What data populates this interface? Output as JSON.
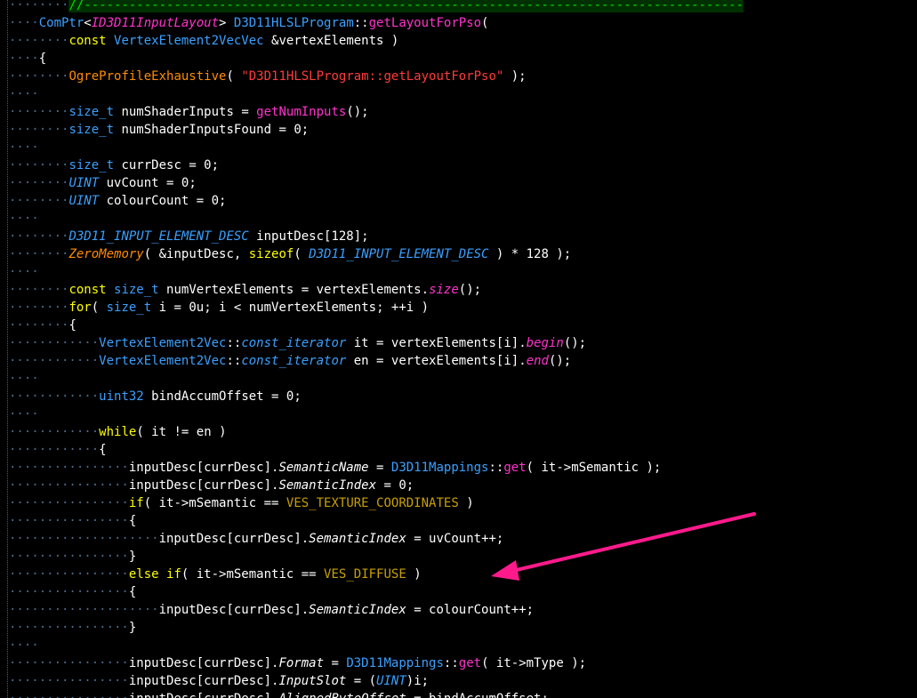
{
  "editor": {
    "language": "C++",
    "colors": {
      "background": "#000000",
      "keyword": "#ffff00",
      "type": "#3aa0ff",
      "function": "#ff33cc",
      "macro": "#ff8c00",
      "string": "#ff3b3b",
      "enum": "#c8a000",
      "comment": "#00e000",
      "annotation_arrow": "#ff1a8c"
    },
    "lines": [
      {
        "indent": 1,
        "tokens": [
          [
            "com",
            "//----------------------------------------------------------------------------------------"
          ]
        ]
      },
      {
        "indent": 0,
        "tokens": [
          [
            "type",
            "ComPtr"
          ],
          [
            "op",
            "<"
          ],
          [
            "tmpl",
            "ID3D11InputLayout"
          ],
          [
            "op",
            "> "
          ],
          [
            "type",
            "D3D11HLSLProgram"
          ],
          [
            "op",
            "::"
          ],
          [
            "fn",
            "getLayoutForPso"
          ],
          [
            "op",
            "("
          ]
        ]
      },
      {
        "indent": 1,
        "tokens": [
          [
            "kw",
            "const "
          ],
          [
            "type",
            "VertexElement2VecVec "
          ],
          [
            "op",
            "&"
          ],
          [
            "def",
            "vertexElements "
          ],
          [
            "op",
            ")"
          ]
        ]
      },
      {
        "indent": 0,
        "tokens": [
          [
            "op",
            "{"
          ]
        ]
      },
      {
        "indent": 1,
        "tokens": [
          [
            "macro",
            "OgreProfileExhaustive"
          ],
          [
            "op",
            "( "
          ],
          [
            "str",
            "\"D3D11HLSLProgram::getLayoutForPso\""
          ],
          [
            "op",
            " );"
          ]
        ]
      },
      {
        "indent": 0,
        "tokens": []
      },
      {
        "indent": 1,
        "tokens": [
          [
            "type",
            "size_t "
          ],
          [
            "def",
            "numShaderInputs "
          ],
          [
            "op",
            "= "
          ],
          [
            "fn",
            "getNumInputs"
          ],
          [
            "op",
            "();"
          ]
        ]
      },
      {
        "indent": 1,
        "tokens": [
          [
            "type",
            "size_t "
          ],
          [
            "def",
            "numShaderInputsFound "
          ],
          [
            "op",
            "= "
          ],
          [
            "num",
            "0"
          ],
          [
            "op",
            ";"
          ]
        ]
      },
      {
        "indent": 0,
        "tokens": []
      },
      {
        "indent": 1,
        "tokens": [
          [
            "type",
            "size_t "
          ],
          [
            "def",
            "currDesc "
          ],
          [
            "op",
            "= "
          ],
          [
            "num",
            "0"
          ],
          [
            "op",
            ";"
          ]
        ]
      },
      {
        "indent": 1,
        "tokens": [
          [
            "typi",
            "UINT "
          ],
          [
            "def",
            "uvCount "
          ],
          [
            "op",
            "= "
          ],
          [
            "num",
            "0"
          ],
          [
            "op",
            ";"
          ]
        ]
      },
      {
        "indent": 1,
        "tokens": [
          [
            "typi",
            "UINT "
          ],
          [
            "def",
            "colourCount "
          ],
          [
            "op",
            "= "
          ],
          [
            "num",
            "0"
          ],
          [
            "op",
            ";"
          ]
        ]
      },
      {
        "indent": 0,
        "tokens": []
      },
      {
        "indent": 1,
        "tokens": [
          [
            "typi",
            "D3D11_INPUT_ELEMENT_DESC "
          ],
          [
            "def",
            "inputDesc"
          ],
          [
            "op",
            "["
          ],
          [
            "num",
            "128"
          ],
          [
            "op",
            "];"
          ]
        ]
      },
      {
        "indent": 1,
        "tokens": [
          [
            "maci",
            "ZeroMemory"
          ],
          [
            "op",
            "( &"
          ],
          [
            "def",
            "inputDesc"
          ],
          [
            "op",
            ", "
          ],
          [
            "kw",
            "sizeof"
          ],
          [
            "op",
            "( "
          ],
          [
            "typi",
            "D3D11_INPUT_ELEMENT_DESC "
          ],
          [
            "op",
            ") * "
          ],
          [
            "num",
            "128 "
          ],
          [
            "op",
            ");"
          ]
        ]
      },
      {
        "indent": 0,
        "tokens": []
      },
      {
        "indent": 1,
        "tokens": [
          [
            "kw",
            "const "
          ],
          [
            "type",
            "size_t "
          ],
          [
            "def",
            "numVertexElements "
          ],
          [
            "op",
            "= "
          ],
          [
            "def",
            "vertexElements"
          ],
          [
            "op",
            "."
          ],
          [
            "fni",
            "size"
          ],
          [
            "op",
            "();"
          ]
        ]
      },
      {
        "indent": 1,
        "tokens": [
          [
            "kw",
            "for"
          ],
          [
            "op",
            "( "
          ],
          [
            "type",
            "size_t "
          ],
          [
            "def",
            "i "
          ],
          [
            "op",
            "= "
          ],
          [
            "num",
            "0u"
          ],
          [
            "op",
            "; "
          ],
          [
            "def",
            "i "
          ],
          [
            "op",
            "< "
          ],
          [
            "def",
            "numVertexElements"
          ],
          [
            "op",
            "; ++"
          ],
          [
            "def",
            "i "
          ],
          [
            "op",
            ")"
          ]
        ]
      },
      {
        "indent": 1,
        "tokens": [
          [
            "op",
            "{"
          ]
        ]
      },
      {
        "indent": 2,
        "tokens": [
          [
            "type",
            "VertexElement2Vec"
          ],
          [
            "op",
            "::"
          ],
          [
            "typi",
            "const_iterator "
          ],
          [
            "def",
            "it "
          ],
          [
            "op",
            "= "
          ],
          [
            "def",
            "vertexElements"
          ],
          [
            "op",
            "["
          ],
          [
            "def",
            "i"
          ],
          [
            "op",
            "]."
          ],
          [
            "fni",
            "begin"
          ],
          [
            "op",
            "();"
          ]
        ]
      },
      {
        "indent": 2,
        "tokens": [
          [
            "type",
            "VertexElement2Vec"
          ],
          [
            "op",
            "::"
          ],
          [
            "typi",
            "const_iterator "
          ],
          [
            "def",
            "en "
          ],
          [
            "op",
            "= "
          ],
          [
            "def",
            "vertexElements"
          ],
          [
            "op",
            "["
          ],
          [
            "def",
            "i"
          ],
          [
            "op",
            "]."
          ],
          [
            "fni",
            "end"
          ],
          [
            "op",
            "();"
          ]
        ]
      },
      {
        "indent": 0,
        "tokens": []
      },
      {
        "indent": 2,
        "tokens": [
          [
            "type",
            "uint32 "
          ],
          [
            "def",
            "bindAccumOffset "
          ],
          [
            "op",
            "= "
          ],
          [
            "num",
            "0"
          ],
          [
            "op",
            ";"
          ]
        ]
      },
      {
        "indent": 0,
        "tokens": []
      },
      {
        "indent": 2,
        "tokens": [
          [
            "kw",
            "while"
          ],
          [
            "op",
            "( "
          ],
          [
            "def",
            "it "
          ],
          [
            "op",
            "!= "
          ],
          [
            "def",
            "en "
          ],
          [
            "op",
            ")"
          ]
        ]
      },
      {
        "indent": 2,
        "tokens": [
          [
            "op",
            "{"
          ]
        ]
      },
      {
        "indent": 3,
        "tokens": [
          [
            "def",
            "inputDesc"
          ],
          [
            "op",
            "["
          ],
          [
            "def",
            "currDesc"
          ],
          [
            "op",
            "]."
          ],
          [
            "mem",
            "SemanticName "
          ],
          [
            "op",
            "= "
          ],
          [
            "type",
            "D3D11Mappings"
          ],
          [
            "op",
            "::"
          ],
          [
            "fn",
            "get"
          ],
          [
            "op",
            "( "
          ],
          [
            "def",
            "it"
          ],
          [
            "op",
            "->"
          ],
          [
            "def",
            "mSemantic "
          ],
          [
            "op",
            ");"
          ]
        ]
      },
      {
        "indent": 3,
        "tokens": [
          [
            "def",
            "inputDesc"
          ],
          [
            "op",
            "["
          ],
          [
            "def",
            "currDesc"
          ],
          [
            "op",
            "]."
          ],
          [
            "mem",
            "SemanticIndex "
          ],
          [
            "op",
            "= "
          ],
          [
            "num",
            "0"
          ],
          [
            "op",
            ";"
          ]
        ]
      },
      {
        "indent": 3,
        "tokens": [
          [
            "kw",
            "if"
          ],
          [
            "op",
            "( "
          ],
          [
            "def",
            "it"
          ],
          [
            "op",
            "->"
          ],
          [
            "def",
            "mSemantic "
          ],
          [
            "op",
            "== "
          ],
          [
            "enum",
            "VES_TEXTURE_COORDINATES "
          ],
          [
            "op",
            ")"
          ]
        ]
      },
      {
        "indent": 3,
        "tokens": [
          [
            "op",
            "{"
          ]
        ]
      },
      {
        "indent": 4,
        "tokens": [
          [
            "def",
            "inputDesc"
          ],
          [
            "op",
            "["
          ],
          [
            "def",
            "currDesc"
          ],
          [
            "op",
            "]."
          ],
          [
            "mem",
            "SemanticIndex "
          ],
          [
            "op",
            "= "
          ],
          [
            "def",
            "uvCount"
          ],
          [
            "op",
            "++;"
          ]
        ]
      },
      {
        "indent": 3,
        "tokens": [
          [
            "op",
            "}"
          ]
        ]
      },
      {
        "indent": 3,
        "tokens": [
          [
            "kw",
            "else "
          ],
          [
            "kw",
            "if"
          ],
          [
            "op",
            "( "
          ],
          [
            "def",
            "it"
          ],
          [
            "op",
            "->"
          ],
          [
            "def",
            "mSemantic "
          ],
          [
            "op",
            "== "
          ],
          [
            "enum",
            "VES_DIFFUSE "
          ],
          [
            "op",
            ")"
          ]
        ]
      },
      {
        "indent": 3,
        "tokens": [
          [
            "op",
            "{"
          ]
        ]
      },
      {
        "indent": 4,
        "tokens": [
          [
            "def",
            "inputDesc"
          ],
          [
            "op",
            "["
          ],
          [
            "def",
            "currDesc"
          ],
          [
            "op",
            "]."
          ],
          [
            "mem",
            "SemanticIndex "
          ],
          [
            "op",
            "= "
          ],
          [
            "def",
            "colourCount"
          ],
          [
            "op",
            "++;"
          ]
        ]
      },
      {
        "indent": 3,
        "tokens": [
          [
            "op",
            "}"
          ]
        ]
      },
      {
        "indent": 0,
        "tokens": []
      },
      {
        "indent": 3,
        "tokens": [
          [
            "def",
            "inputDesc"
          ],
          [
            "op",
            "["
          ],
          [
            "def",
            "currDesc"
          ],
          [
            "op",
            "]."
          ],
          [
            "mem",
            "Format "
          ],
          [
            "op",
            "= "
          ],
          [
            "type",
            "D3D11Mappings"
          ],
          [
            "op",
            "::"
          ],
          [
            "fn",
            "get"
          ],
          [
            "op",
            "( "
          ],
          [
            "def",
            "it"
          ],
          [
            "op",
            "->"
          ],
          [
            "def",
            "mType "
          ],
          [
            "op",
            ");"
          ]
        ]
      },
      {
        "indent": 3,
        "tokens": [
          [
            "def",
            "inputDesc"
          ],
          [
            "op",
            "["
          ],
          [
            "def",
            "currDesc"
          ],
          [
            "op",
            "]."
          ],
          [
            "mem",
            "InputSlot "
          ],
          [
            "op",
            "= ("
          ],
          [
            "typi",
            "UINT"
          ],
          [
            "op",
            ")"
          ],
          [
            "def",
            "i"
          ],
          [
            "op",
            ";"
          ]
        ]
      },
      {
        "indent": 3,
        "tokens": [
          [
            "def",
            "inputDesc"
          ],
          [
            "op",
            "["
          ],
          [
            "def",
            "currDesc"
          ],
          [
            "op",
            "]."
          ],
          [
            "mem",
            "AlignedByteOffset "
          ],
          [
            "op",
            "= "
          ],
          [
            "def",
            "bindAccumOffset"
          ],
          [
            "op",
            ";"
          ]
        ]
      }
    ]
  }
}
